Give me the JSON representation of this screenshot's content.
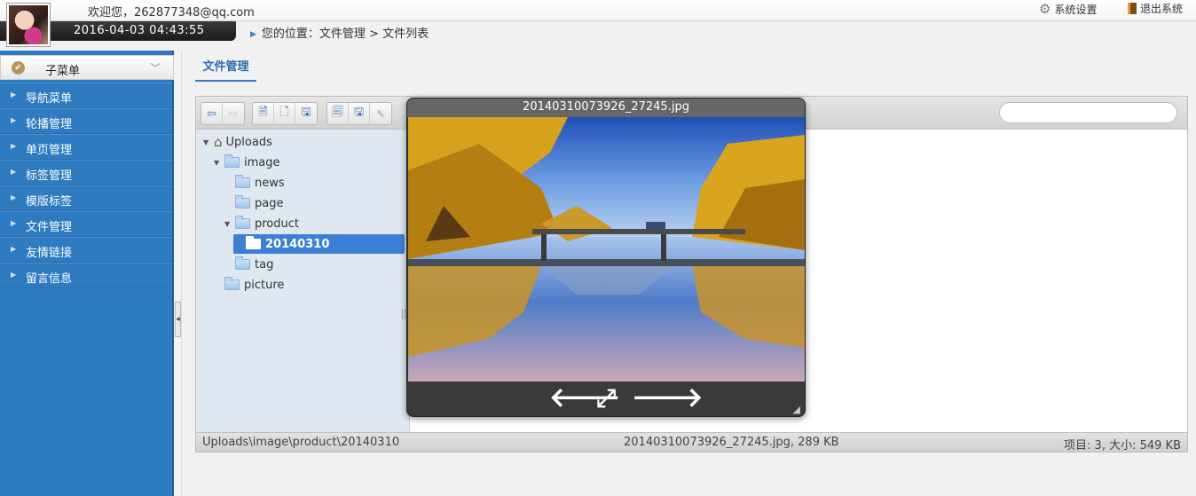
{
  "header": {
    "welcome": "欢迎您，262877348@qq.com",
    "datetime": "2016-04-03 04:43:55",
    "settings_label": "系统设置",
    "logout_label": "退出系统"
  },
  "breadcrumb": "您的位置：文件管理 > 文件列表",
  "tab": {
    "label": "文件管理"
  },
  "sidebar": {
    "header": "子菜单",
    "items": [
      {
        "label": "导航菜单"
      },
      {
        "label": "轮播管理"
      },
      {
        "label": "单页管理"
      },
      {
        "label": "标签管理"
      },
      {
        "label": "模版标签"
      },
      {
        "label": "文件管理"
      },
      {
        "label": "友情链接"
      },
      {
        "label": "留言信息"
      }
    ]
  },
  "file_manager": {
    "search": {
      "value": "",
      "placeholder": ""
    },
    "tree": [
      {
        "label": "Uploads"
      },
      {
        "label": "image"
      },
      {
        "label": "news"
      },
      {
        "label": "page"
      },
      {
        "label": "product"
      },
      {
        "label": "20140310"
      },
      {
        "label": "tag"
      },
      {
        "label": "picture"
      }
    ],
    "status": {
      "path": "Uploads\\image\\product\\20140310",
      "file_info": "20140310073926_27245.jpg, 289 KB",
      "summary": "项目: 3, 大小: 549 KB"
    }
  },
  "preview": {
    "filename": "20140310073926_27245.jpg",
    "prev_glyph": "🡐",
    "fullscreen_glyph": "⤢",
    "next_glyph": "🡒"
  },
  "colors": {
    "sidebar": "#2f7bc2",
    "accent": "#3d7fd3",
    "preview_bg": "#333333"
  }
}
